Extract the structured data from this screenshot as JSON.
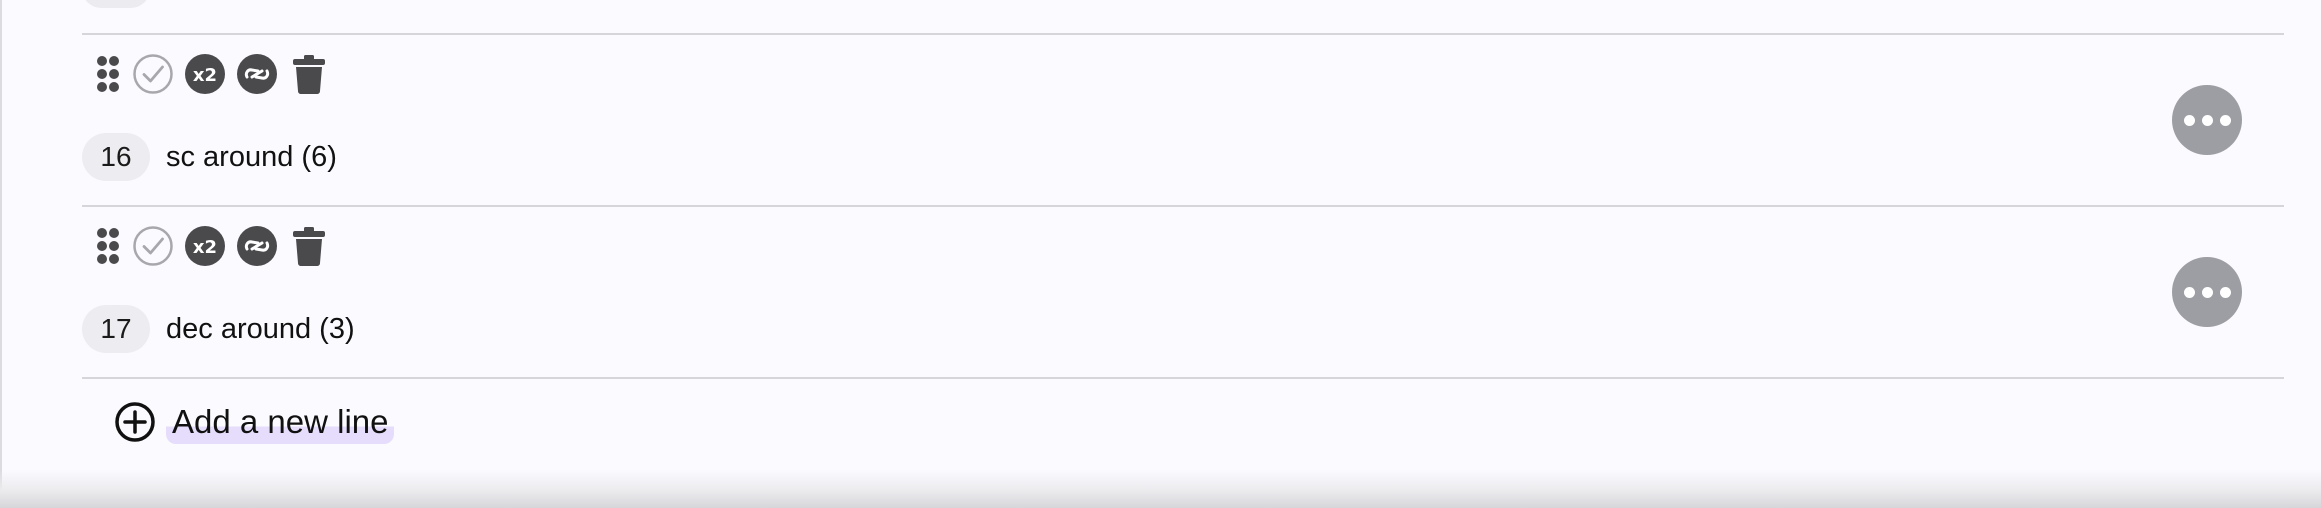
{
  "rows": [
    {
      "number": "16",
      "text": "sc around (6)"
    },
    {
      "number": "17",
      "text": "dec around (3)"
    }
  ],
  "toolbar_icons": [
    "drag-handle-icon",
    "check-circle-icon",
    "x2-icon",
    "link-icon",
    "trash-icon"
  ],
  "add_line": {
    "label": "Add a new line",
    "icon": "plus-circle-icon"
  },
  "colors": {
    "background": "#fbfaff",
    "icon_dark": "#4a4a4d",
    "check_outline": "#a8a8ac",
    "more_button": "#9d9ea3",
    "number_badge": "#ededf1",
    "divider": "#d6d6da",
    "add_highlight": "#e6dcfb"
  }
}
